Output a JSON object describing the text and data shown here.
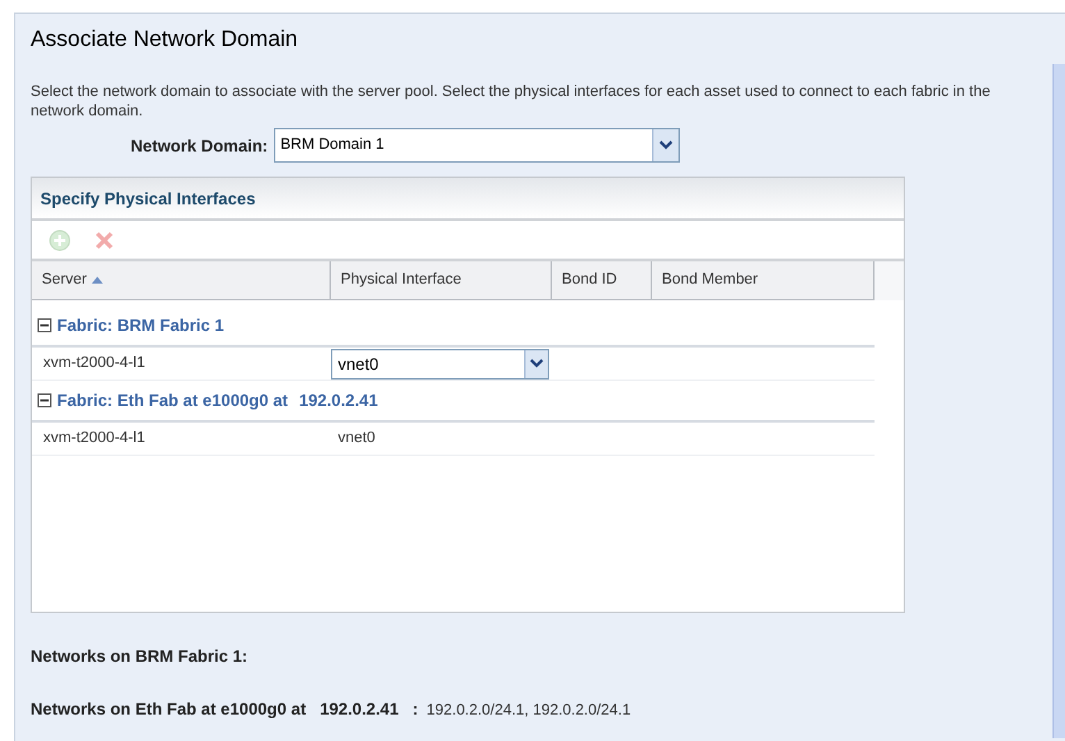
{
  "title": "Associate Network Domain",
  "description": "Select the network domain to associate with the server pool. Select the physical interfaces for each asset used to connect to each fabric in the network domain.",
  "network_domain": {
    "label": "Network Domain:",
    "value": "BRM Domain 1"
  },
  "interfaces_panel": {
    "title": "Specify Physical Interfaces",
    "toolbar": [
      {
        "kind": "add",
        "disabled": true
      },
      {
        "kind": "remove",
        "disabled": true
      }
    ],
    "columns": [
      {
        "label": "Server",
        "sorted": true
      },
      {
        "label": "Physical Interface",
        "sorted": false
      },
      {
        "label": "Bond ID",
        "sorted": false
      },
      {
        "label": "Bond Member",
        "sorted": false
      }
    ],
    "groups": [
      {
        "label": "Fabric: BRM Fabric 1",
        "expanded": true,
        "rows": [
          {
            "server": "xvm-t2000-4-l1",
            "interface": {
              "kind": "dropdown",
              "value": "vnet0"
            }
          }
        ]
      },
      {
        "label": "Fabric: Eth Fab at e1000g0 at",
        "address": "192.0.2.41",
        "expanded": true,
        "rows": [
          {
            "server": "xvm-t2000-4-l1",
            "interface": {
              "kind": "text",
              "value": "vnet0"
            }
          }
        ]
      }
    ]
  },
  "networks": [
    {
      "label": "Networks on BRM Fabric 1:"
    },
    {
      "label": "Networks on Eth Fab at e1000g0 at",
      "address": "192.0.2.41",
      "separator": ":",
      "values": "192.0.2.0/24.1, 192.0.2.0/24.1"
    }
  ]
}
